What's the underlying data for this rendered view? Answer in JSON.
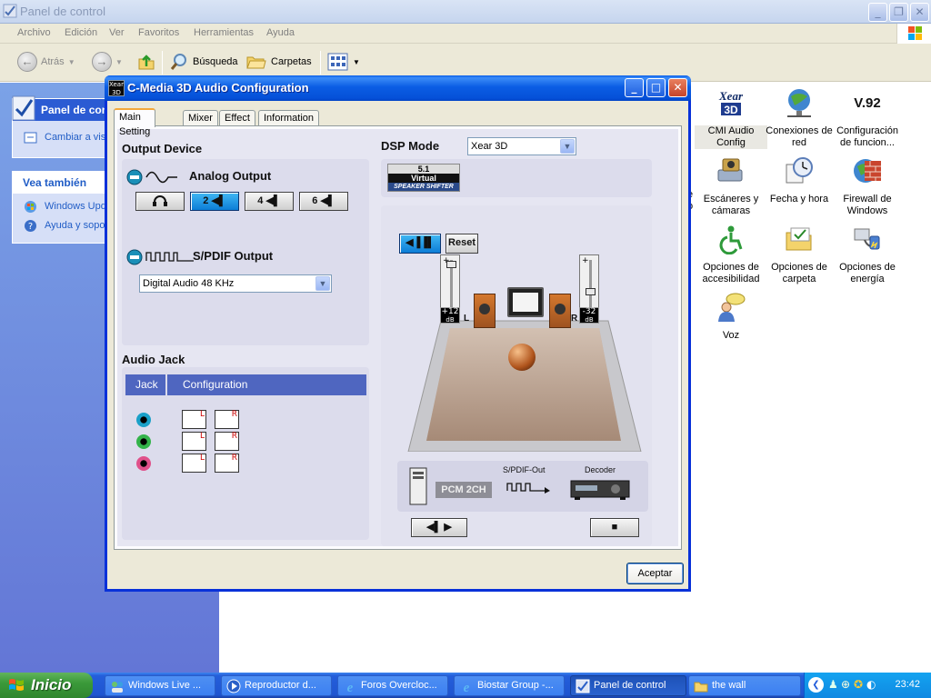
{
  "explorer": {
    "title": "Panel de control",
    "menu": [
      "Archivo",
      "Edición",
      "Ver",
      "Favoritos",
      "Herramientas",
      "Ayuda"
    ],
    "toolbar": {
      "back": "Atrás",
      "search": "Búsqueda",
      "folders": "Carpetas"
    },
    "side_panel": {
      "control_panel_header": "Panel de con",
      "switch_view": "Cambiar a vist",
      "see_also_header": "Vea también",
      "links": [
        "Windows Upd",
        "Ayuda y sopo"
      ]
    },
    "icons": [
      {
        "name": "xear-3d",
        "label": "CMI Audio Config",
        "logo_text": "Xear 3D"
      },
      {
        "name": "network-connections",
        "label": "Conexiones de red"
      },
      {
        "name": "modem-config",
        "label": "Configuración de funcion...",
        "logo_text": "V.92"
      },
      {
        "name": "scanners-cameras",
        "label": "Escáneres y cámaras"
      },
      {
        "name": "date-time",
        "label": "Fecha y hora"
      },
      {
        "name": "windows-firewall",
        "label": "Firewall de Windows"
      },
      {
        "name": "accessibility",
        "label": "Opciones de accesibilidad"
      },
      {
        "name": "folder-options",
        "label": "Opciones de carpeta"
      },
      {
        "name": "power-options",
        "label": "Opciones de energía"
      },
      {
        "name": "speech",
        "label": "Voz"
      }
    ],
    "partial_labels": [
      "e",
      "o"
    ]
  },
  "dialog": {
    "title": "C-Media 3D Audio Configuration",
    "tabs": [
      "Main Setting",
      "Mixer",
      "Effect",
      "Information"
    ],
    "active_tab": "Main Setting",
    "output_device": {
      "header": "Output Device",
      "analog_label": "Analog Output",
      "speaker_buttons": [
        "2",
        "4",
        "6"
      ],
      "selected_speakers": "2",
      "spdif_label": "S/PDIF Output",
      "spdif_value": "Digital Audio 48 KHz"
    },
    "audio_jack": {
      "header": "Audio Jack",
      "columns": [
        "Jack",
        "Configuration"
      ],
      "jacks": [
        {
          "color": "#1aa0c8",
          "config": [
            "L",
            "R"
          ]
        },
        {
          "color": "#33b34a",
          "config": [
            "L",
            "R"
          ]
        },
        {
          "color": "#e0508a",
          "config": [
            "L",
            "R"
          ]
        }
      ]
    },
    "dsp": {
      "header": "DSP Mode",
      "mode": "Xear 3D",
      "badge": {
        "line1": "5.1",
        "line2": "Virtual",
        "line3": "SPEAKER SHIFTER"
      },
      "reset": "Reset",
      "left_gain": "+12",
      "right_gain": "-32",
      "gain_unit": "dB",
      "left_tag": "L",
      "right_tag": "R",
      "plus": "+",
      "minus": "−",
      "pcm": "PCM 2CH",
      "spdif_out": "S/PDIF-Out",
      "decoder": "Decoder"
    },
    "ok_button": "Aceptar"
  },
  "taskbar": {
    "start": "Inicio",
    "tasks": [
      "Windows Live ...",
      "Reproductor d...",
      "Foros Overcloc...",
      "Biostar Group -...",
      "Panel de control",
      "the wall"
    ],
    "active_task": "Panel de control",
    "clock": "23:42"
  },
  "colors": {
    "xp_blue": "#0550d8",
    "taskbar_blue": "#245edb",
    "start_green": "#3b9a3a",
    "jack_header": "#4f66c0"
  }
}
